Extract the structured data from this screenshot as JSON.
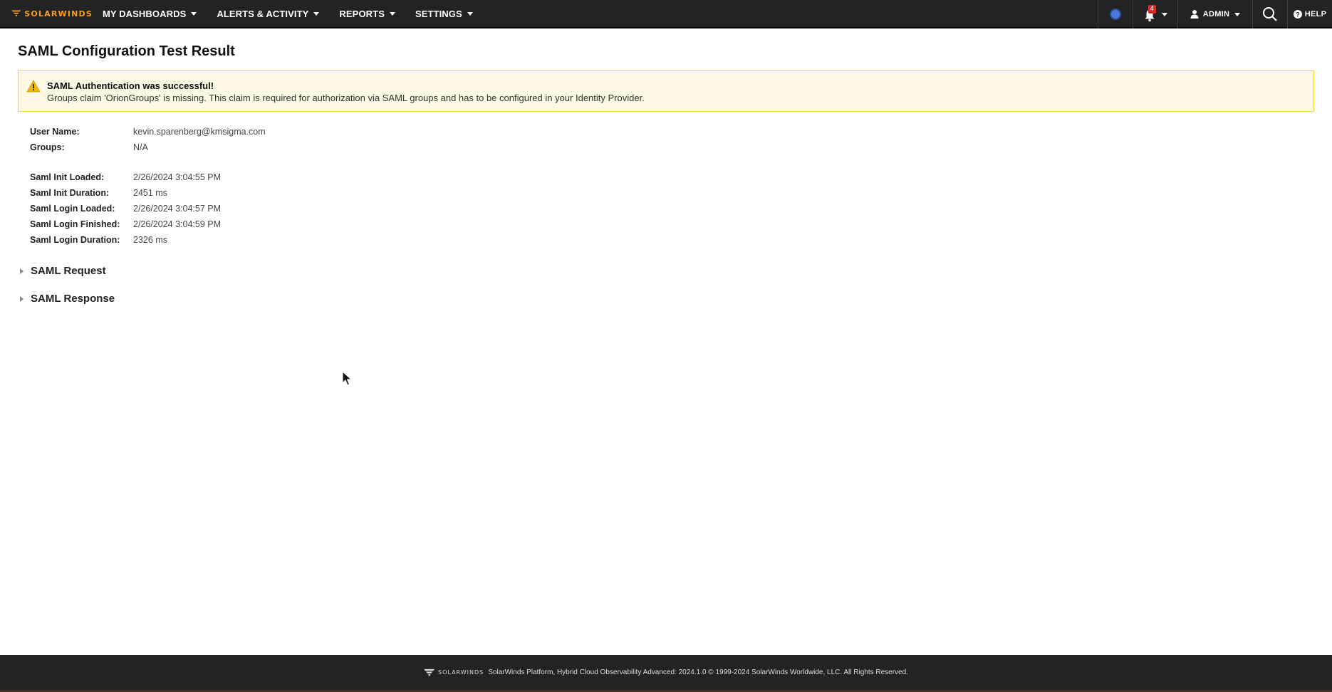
{
  "brand": {
    "name": "SOLARWINDS",
    "color": "#f99d1c"
  },
  "nav": {
    "items": [
      {
        "label": "MY DASHBOARDS"
      },
      {
        "label": "ALERTS & ACTIVITY"
      },
      {
        "label": "REPORTS"
      },
      {
        "label": "SETTINGS"
      }
    ],
    "notifications_count": "4",
    "user_label": "ADMIN",
    "help_label": "HELP"
  },
  "page": {
    "title": "SAML Configuration Test Result"
  },
  "alert": {
    "title": "SAML Authentication was successful!",
    "body": "Groups claim 'OrionGroups' is missing. This claim is required for authorization via SAML groups and has to be configured in your Identity Provider.",
    "icon": "warning-icon"
  },
  "user_info": [
    {
      "label": "User Name:",
      "value": "kevin.sparenberg@kmsigma.com"
    },
    {
      "label": "Groups:",
      "value": "N/A"
    }
  ],
  "timing_info": [
    {
      "label": "Saml Init Loaded:",
      "value": "2/26/2024 3:04:55 PM"
    },
    {
      "label": "Saml Init Duration:",
      "value": "2451 ms"
    },
    {
      "label": "Saml Login Loaded:",
      "value": "2/26/2024 3:04:57 PM"
    },
    {
      "label": "Saml Login Finished:",
      "value": "2/26/2024 3:04:59 PM"
    },
    {
      "label": "Saml Login Duration:",
      "value": "2326 ms"
    }
  ],
  "sections": [
    {
      "label": "SAML Request"
    },
    {
      "label": "SAML Response"
    }
  ],
  "footer": {
    "brand": "SOLARWINDS",
    "text": "SolarWinds Platform, Hybrid Cloud Observability Advanced: 2024.1.0 © 1999-2024 SolarWinds Worldwide, LLC. All Rights Reserved."
  }
}
